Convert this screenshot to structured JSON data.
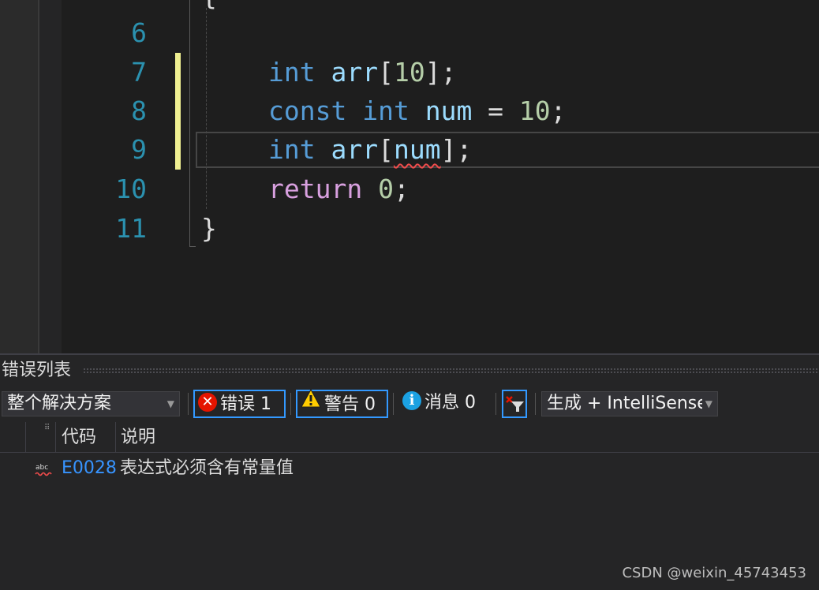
{
  "editor": {
    "lines": [
      {
        "number": "6"
      },
      {
        "number": "7",
        "tokens": [
          [
            "int",
            "kw"
          ],
          [
            " ",
            ""
          ],
          [
            "arr",
            "id"
          ],
          [
            "[",
            "pun"
          ],
          [
            "10",
            "num"
          ],
          [
            "];",
            "pun"
          ]
        ]
      },
      {
        "number": "8",
        "tokens": [
          [
            "const",
            "kw"
          ],
          [
            " ",
            ""
          ],
          [
            "int",
            "kw"
          ],
          [
            " ",
            ""
          ],
          [
            "num",
            "id"
          ],
          [
            " = ",
            "pun"
          ],
          [
            "10",
            "num"
          ],
          [
            ";",
            "pun"
          ]
        ]
      },
      {
        "number": "9"
      },
      {
        "number": "10",
        "tokens": [
          [
            "return",
            "ctl"
          ],
          [
            " ",
            ""
          ],
          [
            "0",
            "num"
          ],
          [
            ";",
            "pun"
          ]
        ]
      },
      {
        "number": "11"
      }
    ],
    "line9": {
      "kw": "int",
      "ident": "arr",
      "open": "[",
      "bad_ident": "num",
      "close": "];"
    },
    "open_brace": "{",
    "close_brace": "}",
    "colors": {
      "keyword": "#569cd6",
      "control": "#d8a0df",
      "identifier": "#9cdcfe",
      "number": "#b5cea8",
      "line_number": "#2b91af",
      "changed_margin": "#efef91",
      "squiggle": "#f14c4c"
    }
  },
  "error_list": {
    "title": "错误列表",
    "scope": "整个解决方案",
    "errors_label": "错误 1",
    "warnings_label": "警告 0",
    "messages_label": "消息 0",
    "source": "生成 + IntelliSense",
    "columns": {
      "code": "代码",
      "description": "说明"
    },
    "rows": [
      {
        "icon": "spelling-error-icon",
        "code": "E0028",
        "description": "表达式必须含有常量值"
      }
    ]
  },
  "watermark": "CSDN @weixin_45743453"
}
